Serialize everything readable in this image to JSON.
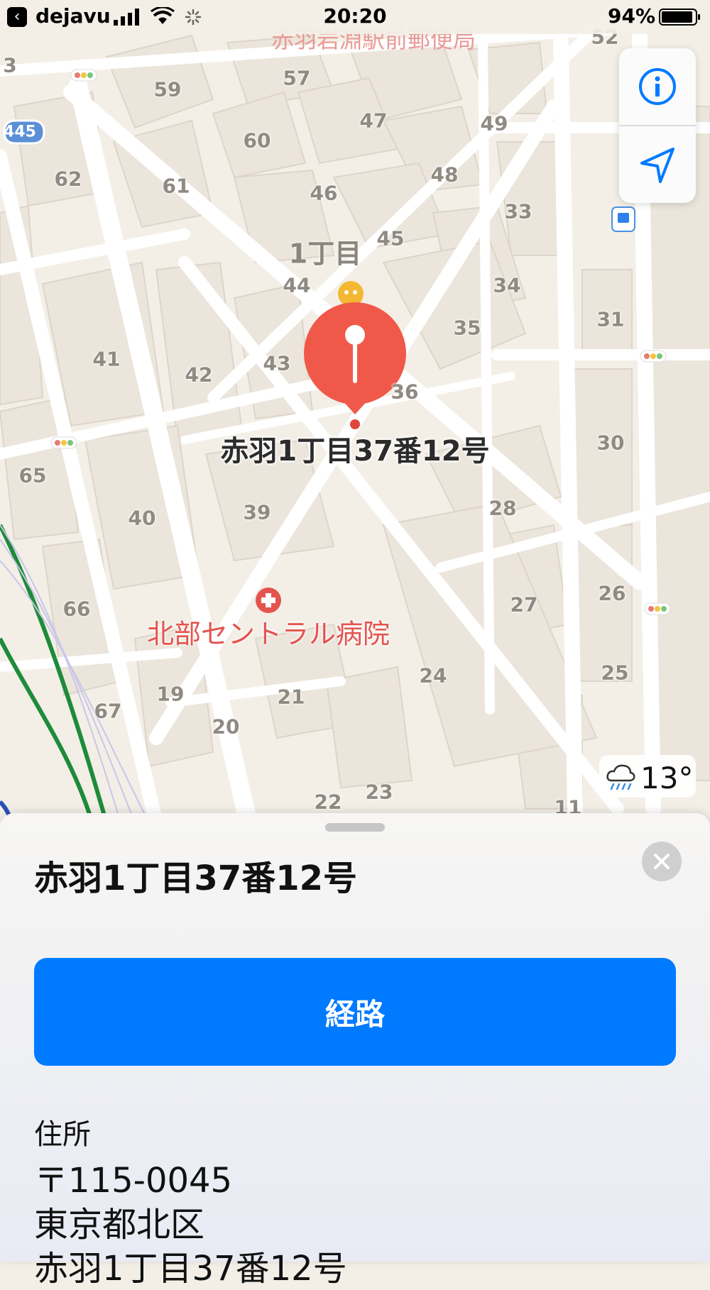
{
  "status_bar": {
    "back_app": "dejavu",
    "time": "20:20",
    "battery_percent": "94%",
    "battery_level": 0.94
  },
  "map": {
    "post_office": "赤羽岩淵駅前郵便局",
    "district": "1丁目",
    "hospital": "北部セントラル病院",
    "route_shield": "445",
    "pin_label": "赤羽1丁目37番12号",
    "block_numbers": [
      "3",
      "52",
      "59",
      "57",
      "47",
      "49",
      "60",
      "62",
      "61",
      "46",
      "48",
      "33",
      "45",
      "44",
      "34",
      "31",
      "35",
      "41",
      "42",
      "43",
      "36",
      "65",
      "30",
      "40",
      "39",
      "28",
      "66",
      "26",
      "27",
      "24",
      "25",
      "67",
      "19",
      "21",
      "20",
      "22",
      "23",
      "11"
    ]
  },
  "weather": {
    "icon": "rain-cloud-icon",
    "temperature": "13°"
  },
  "sheet": {
    "title": "赤羽1丁目37番12号",
    "route_button": "経路",
    "address_label": "住所",
    "address_lines": [
      "〒115-0045",
      "東京都北区",
      "赤羽1丁目37番12号"
    ]
  },
  "colors": {
    "accent": "#007aff",
    "pin": "#f0594a",
    "hospital_text": "#e4544f",
    "rail_green": "#1e8b3a"
  }
}
